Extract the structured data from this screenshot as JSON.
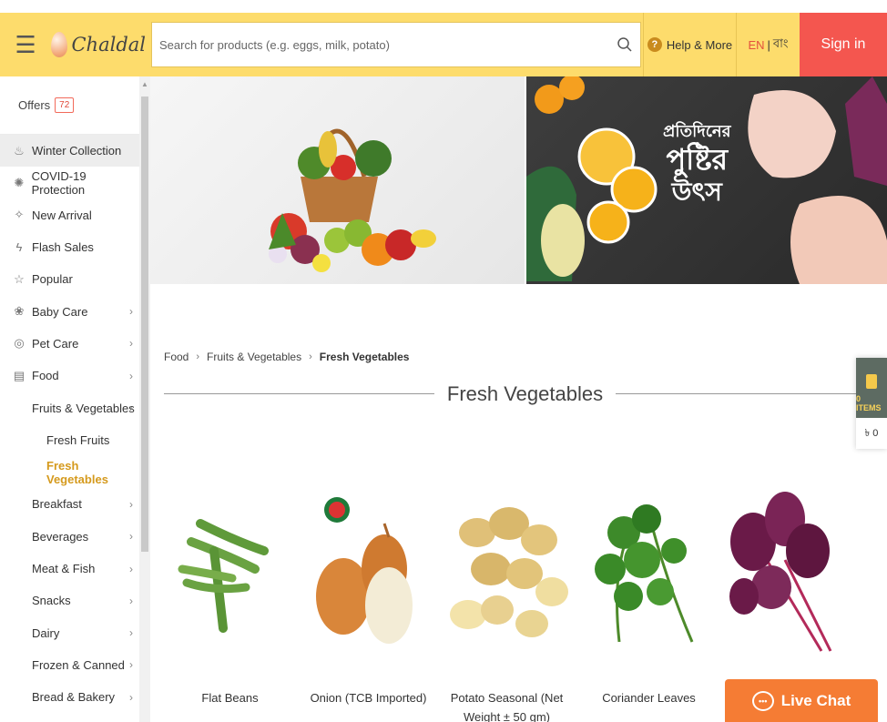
{
  "header": {
    "menu_icon": "hamburger-icon",
    "logo_text": "Chaldal",
    "search_placeholder": "Search for products (e.g. eggs, milk, potato)",
    "search_icon": "search-icon",
    "help_label": "Help & More",
    "help_icon_glyph": "?",
    "lang_en": "EN",
    "lang_sep": "|",
    "lang_bn": "বাং",
    "signin_label": "Sign in"
  },
  "sidebar": {
    "offers_label": "Offers",
    "offers_count": "72",
    "items": [
      {
        "label": "Winter Collection",
        "icon": "winter-icon",
        "chevron": false,
        "level": 0,
        "active": true
      },
      {
        "label": "COVID-19 Protection",
        "icon": "virus-icon",
        "chevron": false,
        "level": 0
      },
      {
        "label": "New Arrival",
        "icon": "new-arrival-icon",
        "chevron": false,
        "level": 0
      },
      {
        "label": "Flash Sales",
        "icon": "flash-icon",
        "chevron": false,
        "level": 0
      },
      {
        "label": "Popular",
        "icon": "star-icon",
        "chevron": false,
        "level": 0
      },
      {
        "label": "Baby Care",
        "icon": "baby-icon",
        "chevron": true,
        "level": 0
      },
      {
        "label": "Pet Care",
        "icon": "pet-icon",
        "chevron": true,
        "level": 0
      },
      {
        "label": "Food",
        "icon": "food-icon",
        "chevron": true,
        "level": 0
      },
      {
        "label": "Fruits & Vegetables",
        "chevron": true,
        "level": 1
      },
      {
        "label": "Fresh Fruits",
        "chevron": false,
        "level": 2
      },
      {
        "label": "Fresh Vegetables",
        "chevron": false,
        "level": 2,
        "selected": true
      },
      {
        "label": "Breakfast",
        "chevron": true,
        "level": 1
      },
      {
        "label": "Beverages",
        "chevron": true,
        "level": 1
      },
      {
        "label": "Meat & Fish",
        "chevron": true,
        "level": 1
      },
      {
        "label": "Snacks",
        "chevron": true,
        "level": 1
      },
      {
        "label": "Dairy",
        "chevron": true,
        "level": 1
      },
      {
        "label": "Frozen & Canned",
        "chevron": true,
        "level": 1
      },
      {
        "label": "Bread & Bakery",
        "chevron": true,
        "level": 1
      }
    ]
  },
  "banners": {
    "right_text_line1": "প্রতিদিনের",
    "right_text_line2": "পুষ্টির",
    "right_text_line3": "উৎস"
  },
  "breadcrumb": {
    "items": [
      "Food",
      "Fruits & Vegetables",
      "Fresh Vegetables"
    ],
    "separator": "›"
  },
  "section_title": "Fresh Vegetables",
  "products": [
    {
      "name": "Flat Beans",
      "image": "flat-beans"
    },
    {
      "name": "Onion (TCB Imported)",
      "image": "onion"
    },
    {
      "name": "Potato Seasonal (Net Weight ± 50 gm)",
      "image": "potato"
    },
    {
      "name": "Coriander Leaves",
      "image": "coriander"
    },
    {
      "name": "",
      "image": "red-amaranth"
    }
  ],
  "cart": {
    "items_label": "0 ITEMS",
    "total": "৳ 0"
  },
  "live_chat_label": "Live Chat",
  "colors": {
    "header_bg": "#fddc6c",
    "signin_bg": "#f4564f",
    "accent": "#d59a1d",
    "live_chat": "#f57c34"
  }
}
